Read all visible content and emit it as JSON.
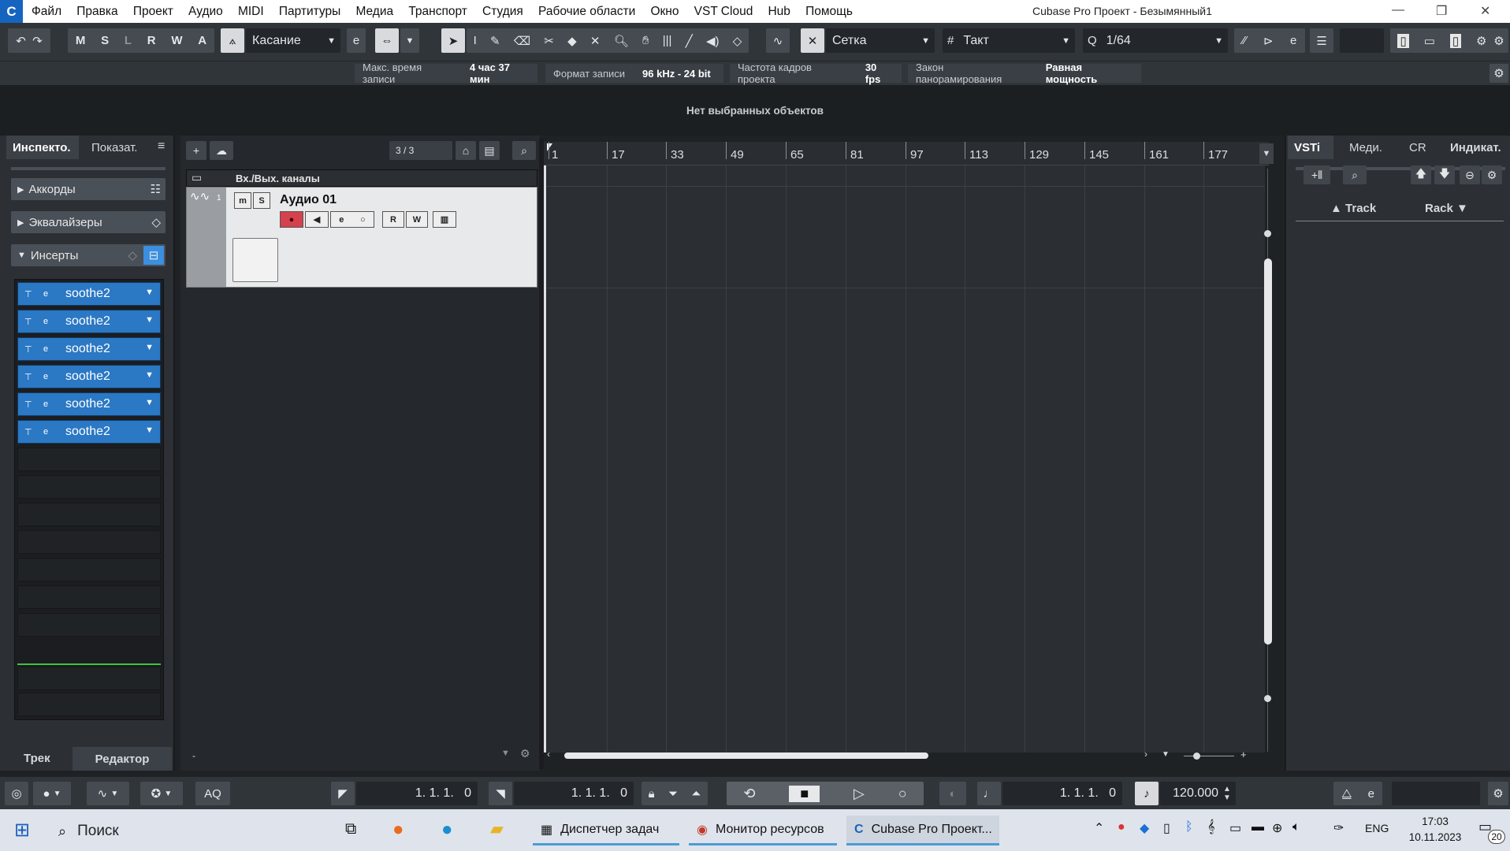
{
  "app": {
    "title": "Cubase Pro Проект - Безымянный1",
    "menu": [
      "Файл",
      "Правка",
      "Проект",
      "Аудио",
      "MIDI",
      "Партитуры",
      "Медиа",
      "Транспорт",
      "Студия",
      "Рабочие области",
      "Окно",
      "VST Cloud",
      "Hub",
      "Помощь"
    ]
  },
  "toolbar": {
    "mode_buttons": [
      "M",
      "S",
      "L",
      "R",
      "W",
      "A"
    ],
    "automation_mode": "Касание",
    "snap_type": "Сетка",
    "grid_type": "Такт",
    "quantize": "1/64"
  },
  "infoline": [
    {
      "label": "Макс. время записи",
      "value": "4 час 37 мин"
    },
    {
      "label": "Формат записи",
      "value": "96 kHz - 24 bit"
    },
    {
      "label": "Частота кадров проекта",
      "value": "30 fps"
    },
    {
      "label": "Закон панорамирования",
      "value": "Равная мощность"
    }
  ],
  "status": "Нет выбранных объектов",
  "inspector": {
    "tabs": [
      "Инспекто.",
      "Показат."
    ],
    "sections": [
      "Аккорды",
      "Эквалайзеры",
      "Инсерты"
    ],
    "inserts": [
      "soothe2",
      "soothe2",
      "soothe2",
      "soothe2",
      "soothe2",
      "soothe2"
    ],
    "bottom_tabs": [
      "Трек",
      "Редактор"
    ]
  },
  "tracklist": {
    "counter": "3 / 3",
    "folder_name": "Вх./Вых. каналы",
    "track_number": "1",
    "track_name": "Аудио 01",
    "mute_label": "m",
    "solo_label": "S",
    "read_label": "R",
    "write_label": "W"
  },
  "ruler": [
    "1",
    "17",
    "33",
    "49",
    "65",
    "81",
    "97",
    "113",
    "129",
    "145",
    "161",
    "177"
  ],
  "rightzone": {
    "tabs": [
      "VSTi",
      "Меди.",
      "CR",
      "Индикат."
    ],
    "col_track": "Track",
    "col_rack": "Rack"
  },
  "transport": {
    "aq": "AQ",
    "left_locator": "1. 1. 1.   0",
    "right_locator": "1. 1. 1.   0",
    "position": "1. 1. 1.   0",
    "tempo": "120.000"
  },
  "taskbar": {
    "search": "Поиск",
    "apps": [
      "Диспетчер задач",
      "Монитор ресурсов",
      "Cubase Pro Проект..."
    ],
    "lang": "ENG",
    "time": "17:03",
    "date": "10.11.2023",
    "notifications": "20"
  }
}
